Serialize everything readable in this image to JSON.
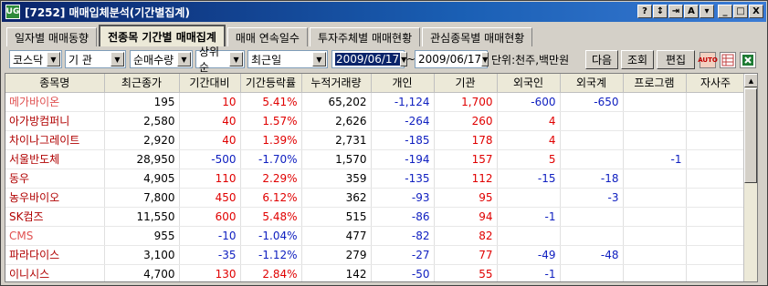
{
  "window": {
    "logo": "UG",
    "title": "[7252] 매매입체분석(기간별집계)",
    "buttons": [
      "?",
      "↕",
      "⇥",
      "A",
      "▾",
      "_",
      "□",
      "X"
    ]
  },
  "tabs": [
    {
      "label": "일자별 매매동향"
    },
    {
      "label": "전종목 기간별 매매집계",
      "active": true
    },
    {
      "label": "매매 연속일수"
    },
    {
      "label": "투자주체별 매매현황"
    },
    {
      "label": "관심종목별 매매현황"
    }
  ],
  "controls": {
    "market": "코스닥",
    "investor": "기 관",
    "sort": "순매수량",
    "rank": "상위순",
    "period": "최근일",
    "date_from": "2009/06/17",
    "date_sep": "~",
    "date_to": "2009/06/17",
    "unit": "단위:천주,백만원",
    "next": "다음",
    "query": "조회",
    "edit": "편집"
  },
  "table": {
    "headers": [
      "종목명",
      "최근종가",
      "기간대비",
      "기간등락률",
      "누적거래량",
      "개인",
      "기관",
      "외국인",
      "외국계",
      "프로그램",
      "자사주"
    ],
    "rows": [
      {
        "name": "메가바이온",
        "c": "pink",
        "close": "195",
        "diff": "10",
        "rate": "5.41%",
        "vol": "65,202",
        "ind": "-1,124",
        "inst": "1,700",
        "for": "-600",
        "forc": "-650",
        "prog": "",
        "own": "",
        "dc": "red"
      },
      {
        "name": "아가방컴퍼니",
        "c": "dk",
        "close": "2,580",
        "diff": "40",
        "rate": "1.57%",
        "vol": "2,626",
        "ind": "-264",
        "inst": "260",
        "for": "4",
        "forc": "",
        "prog": "",
        "own": "",
        "dc": "red"
      },
      {
        "name": "차이나그레이트",
        "c": "dk",
        "close": "2,920",
        "diff": "40",
        "rate": "1.39%",
        "vol": "2,731",
        "ind": "-185",
        "inst": "178",
        "for": "4",
        "forc": "",
        "prog": "",
        "own": "",
        "dc": "red"
      },
      {
        "name": "서울반도체",
        "c": "dk",
        "close": "28,950",
        "diff": "-500",
        "rate": "-1.70%",
        "vol": "1,570",
        "ind": "-194",
        "inst": "157",
        "for": "5",
        "forc": "",
        "prog": "-1",
        "own": "",
        "dc": "blue"
      },
      {
        "name": "동우",
        "c": "dk",
        "close": "4,905",
        "diff": "110",
        "rate": "2.29%",
        "vol": "359",
        "ind": "-135",
        "inst": "112",
        "for": "-15",
        "forc": "-18",
        "prog": "",
        "own": "",
        "dc": "red"
      },
      {
        "name": "농우바이오",
        "c": "dk",
        "close": "7,800",
        "diff": "450",
        "rate": "6.12%",
        "vol": "362",
        "ind": "-93",
        "inst": "95",
        "for": "",
        "forc": "-3",
        "prog": "",
        "own": "",
        "dc": "red"
      },
      {
        "name": "SK컴즈",
        "c": "dk",
        "close": "11,550",
        "diff": "600",
        "rate": "5.48%",
        "vol": "515",
        "ind": "-86",
        "inst": "94",
        "for": "-1",
        "forc": "",
        "prog": "",
        "own": "",
        "dc": "red"
      },
      {
        "name": "CMS",
        "c": "pink",
        "close": "955",
        "diff": "-10",
        "rate": "-1.04%",
        "vol": "477",
        "ind": "-82",
        "inst": "82",
        "for": "",
        "forc": "",
        "prog": "",
        "own": "",
        "dc": "blue"
      },
      {
        "name": "파라다이스",
        "c": "dk",
        "close": "3,100",
        "diff": "-35",
        "rate": "-1.12%",
        "vol": "279",
        "ind": "-27",
        "inst": "77",
        "for": "-49",
        "forc": "-48",
        "prog": "",
        "own": "",
        "dc": "blue"
      },
      {
        "name": "이니시스",
        "c": "dk",
        "close": "4,700",
        "diff": "130",
        "rate": "2.84%",
        "vol": "142",
        "ind": "-50",
        "inst": "55",
        "for": "-1",
        "forc": "",
        "prog": "",
        "own": "",
        "dc": "red"
      }
    ]
  }
}
